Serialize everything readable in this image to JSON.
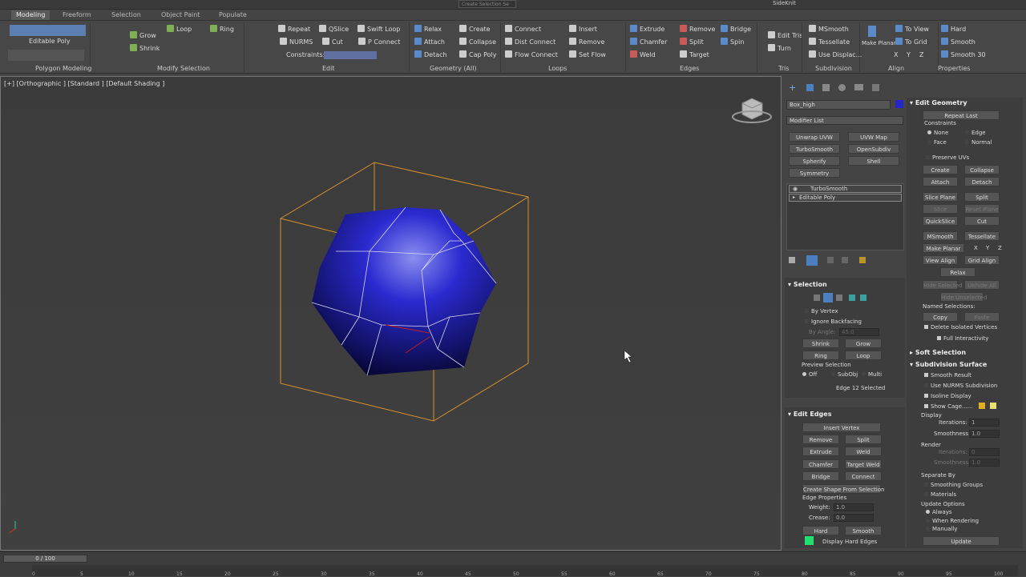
{
  "window": {
    "title": "SideKnit"
  },
  "tabs": [
    "Modeling",
    "Freeform",
    "Selection",
    "Object Paint",
    "Populate"
  ],
  "ribbon": {
    "editable_poly": "Editable Poly",
    "grow": "Grow",
    "shrink": "Shrink",
    "loop": "Loop",
    "ring": "Ring",
    "repeat": "Repeat",
    "qslice": "QSlice",
    "swift_loop": "Swift Loop",
    "nurms": "NURMS",
    "cut": "Cut",
    "p_connect": "P Connect",
    "constraints": "Constraints:",
    "relax": "Relax",
    "create": "Create",
    "attach": "Attach",
    "collapse": "Collapse",
    "detach": "Detach",
    "cap_poly": "Cap Poly",
    "connect": "Connect",
    "dist_connect": "Dist Connect",
    "flow_connect": "Flow Connect",
    "insert": "Insert",
    "remove": "Remove",
    "set_flow": "Set Flow",
    "extrude": "Extrude",
    "remove2": "Remove",
    "bridge": "Bridge",
    "chamfer": "Chamfer",
    "split": "Split",
    "spin": "Spin",
    "weld": "Weld",
    "target": "Target",
    "edit_tris": "Edit Tris",
    "turn": "Turn",
    "msmooth": "MSmooth",
    "tessellate": "Tessellate",
    "use_displac": "Use Displac...",
    "make_planar": "Make Planar",
    "xyz": [
      "X",
      "Y",
      "Z"
    ],
    "to_view": "To View",
    "to_grid": "To Grid",
    "hard": "Hard",
    "smooth": "Smooth",
    "smooth30": "Smooth 30",
    "groups": [
      "Polygon Modeling",
      "Modify Selection",
      "Edit",
      "Geometry (All)",
      "Loops",
      "Edges",
      "Tris",
      "Subdivision",
      "Align",
      "Properties"
    ],
    "selset_placeholder": "Create Selection Se"
  },
  "viewport": {
    "label": "[+] [Orthographic ] [Standard ] [Default Shading ]"
  },
  "command_panel": {
    "object_name": "Box_high",
    "modifier_list": "Modifier List",
    "modifier_buttons": [
      "Unwrap UVW",
      "UVW Map",
      "TurboSmooth",
      "OpenSubdiv",
      "Spherify",
      "Shell",
      "Symmetry"
    ],
    "stack": [
      "TurboSmooth",
      "Editable Poly"
    ],
    "selection": {
      "title": "Selection",
      "by_vertex": "By Vertex",
      "ignore_backfacing": "Ignore Backfacing",
      "by_angle": "By Angle:",
      "angle_value": "45.0",
      "shrink": "Shrink",
      "grow": "Grow",
      "ring": "Ring",
      "loop": "Loop",
      "preview": "Preview Selection",
      "preview_opts": [
        "Off",
        "SubObj",
        "Multi"
      ],
      "status": "Edge 12 Selected"
    },
    "edit_edges": {
      "title": "Edit Edges",
      "insert_vertex": "Insert Vertex",
      "remove": "Remove",
      "split": "Split",
      "extrude": "Extrude",
      "weld": "Weld",
      "chamfer": "Chamfer",
      "target_weld": "Target Weld",
      "bridge": "Bridge",
      "connect": "Connect",
      "create_shape": "Create Shape From Selection",
      "edge_props": "Edge Properties",
      "weight": "Weight:",
      "weight_val": "1.0",
      "crease": "Crease:",
      "crease_val": "0.0",
      "hard": "Hard",
      "smooth": "Smooth",
      "display_hard": "Display Hard Edges"
    }
  },
  "edit_geometry": {
    "title": "Edit Geometry",
    "repeat_last": "Repeat Last",
    "constraints": "Constraints",
    "constraint_opts": [
      "None",
      "Edge",
      "Face",
      "Normal"
    ],
    "preserve_uvs": "Preserve UVs",
    "create": "Create",
    "collapse": "Collapse",
    "attach": "Attach",
    "detach": "Detach",
    "slice_plane": "Slice Plane",
    "split": "Split",
    "slice": "Slice",
    "reset_plane": "Reset Plane",
    "quickslice": "QuickSlice",
    "cut": "Cut",
    "msmooth": "MSmooth",
    "tessellate": "Tessellate",
    "make_planar": "Make Planar",
    "xyz": [
      "X",
      "Y",
      "Z"
    ],
    "view_align": "View Align",
    "grid_align": "Grid Align",
    "relax": "Relax",
    "hide_selected": "Hide Selected",
    "unhide_all": "Unhide All",
    "hide_unselected": "Hide Unselected",
    "named_sel": "Named Selections:",
    "copy": "Copy",
    "paste": "Paste",
    "delete_isolated": "Delete Isolated Vertices",
    "full_interactivity": "Full Interactivity"
  },
  "soft_selection": {
    "title": "Soft Selection"
  },
  "subdivision_surface": {
    "title": "Subdivision Surface",
    "smooth_result": "Smooth Result",
    "use_nurms": "Use NURMS Subdivision",
    "isoline": "Isoline Display",
    "show_cage": "Show Cage......",
    "display": "Display",
    "iterations": "Iterations:",
    "iter_val": "1",
    "smoothness": "Smoothness:",
    "smooth_val": "1.0",
    "render": "Render",
    "r_iter_val": "0",
    "r_smooth_val": "1.0",
    "separate_by": "Separate By",
    "smoothing_groups": "Smoothing Groups",
    "materials": "Materials",
    "update_options": "Update Options",
    "update_opts": [
      "Always",
      "When Rendering",
      "Manually"
    ],
    "update": "Update"
  },
  "timeline": {
    "frame": "0 / 100",
    "ticks": [
      "0",
      "5",
      "10",
      "15",
      "20",
      "25",
      "30",
      "35",
      "40",
      "45",
      "50",
      "55",
      "60",
      "65",
      "70",
      "75",
      "80",
      "85",
      "90",
      "95",
      "100"
    ]
  },
  "colors": {
    "object": "#2626c8",
    "bbox": "#d8922a",
    "hard_edge_swatch": "#22e070",
    "cage1": "#e0b020",
    "cage2": "#e8e070"
  }
}
